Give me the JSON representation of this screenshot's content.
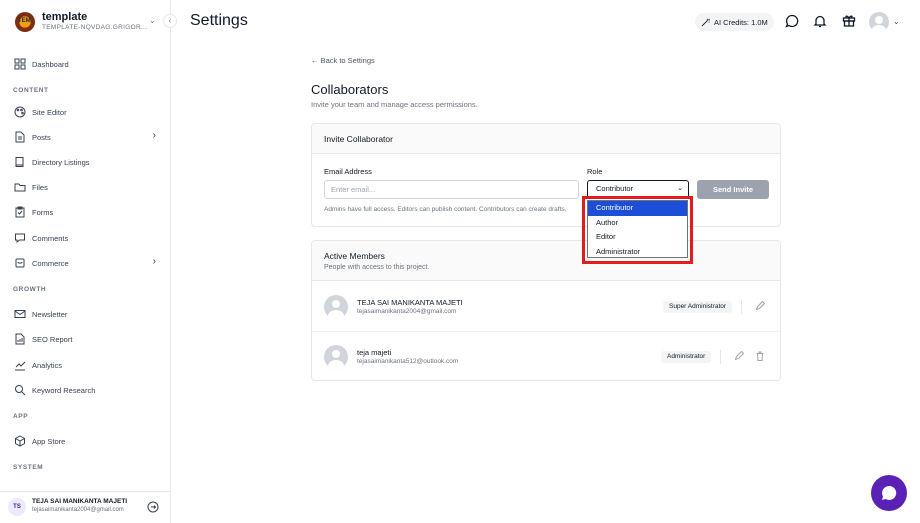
{
  "brand": {
    "name": "template",
    "subtitle": "TEMPLATE-NQVDAG.GRIGOR...",
    "logo_text": "TEM"
  },
  "header": {
    "title": "Settings",
    "credits_label": "AI Credits: 1.0M"
  },
  "sidebar": {
    "items": [
      {
        "label": "Dashboard",
        "icon": "dashboard-icon"
      },
      {
        "label": "Site Editor",
        "icon": "palette-icon"
      },
      {
        "label": "Posts",
        "icon": "document-icon"
      },
      {
        "label": "Directory Listings",
        "icon": "book-icon"
      },
      {
        "label": "Files",
        "icon": "folder-icon"
      },
      {
        "label": "Forms",
        "icon": "clipboard-icon"
      },
      {
        "label": "Comments",
        "icon": "comment-icon"
      },
      {
        "label": "Commerce",
        "icon": "cart-icon"
      },
      {
        "label": "Newsletter",
        "icon": "mail-icon"
      },
      {
        "label": "SEO Report",
        "icon": "report-icon"
      },
      {
        "label": "Analytics",
        "icon": "chart-icon"
      },
      {
        "label": "Keyword Research",
        "icon": "search-icon"
      },
      {
        "label": "App Store",
        "icon": "cube-icon"
      }
    ],
    "sections": {
      "content": "CONTENT",
      "growth": "GROWTH",
      "app": "APP",
      "system": "SYSTEM"
    },
    "user": {
      "initials": "TS",
      "name": "TEJA SAI MANIKANTA MAJETI",
      "email": "tejasaimanikanta2004@gmail.com"
    }
  },
  "main": {
    "back_link": "← Back to Settings",
    "title": "Collaborators",
    "subtitle": "Invite your team and manage access permissions.",
    "invite": {
      "title": "Invite Collaborator",
      "email_label": "Email Address",
      "email_placeholder": "Enter email...",
      "role_label": "Role",
      "role_value": "Contributor",
      "send_label": "Send Invite",
      "hint": "Admins have full access. Editors can publish content. Contributors can create drafts.",
      "role_options": [
        "Contributor",
        "Author",
        "Editor",
        "Administrator"
      ]
    },
    "members": {
      "title": "Active Members",
      "subtitle": "People with access to this project.",
      "rows": [
        {
          "name": "TEJA SAI MANIKANTA MAJETI",
          "email": "tejasaimanikanta2004@gmail.com",
          "role": "Super Administrator"
        },
        {
          "name": "teja majeti",
          "email": "tejasaimanikanta512@outlook.com",
          "role": "Administrator"
        }
      ]
    }
  },
  "colors": {
    "accent": "#5b21b6",
    "selected_option": "#1d4ed8",
    "highlight": "#e11d1d"
  }
}
